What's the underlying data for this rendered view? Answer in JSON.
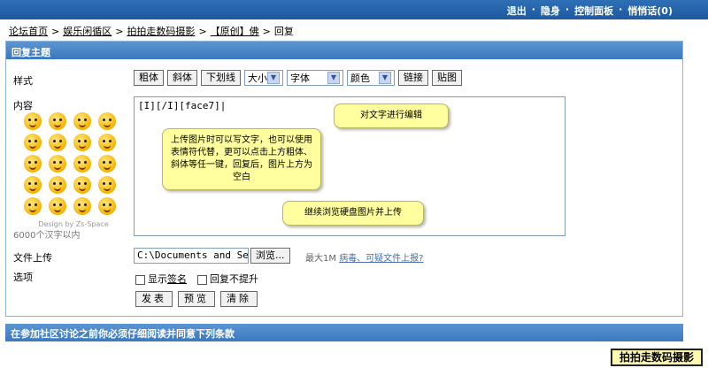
{
  "topbar": {
    "links": [
      "退出",
      "隐身",
      "控制面板",
      "悄悄话(0)"
    ]
  },
  "breadcrumb": [
    "论坛首页",
    "娱乐闲循区",
    "拍拍走数码摄影",
    "【原创】佛",
    "回复"
  ],
  "panel": {
    "title": "回复主题"
  },
  "labels": {
    "style": "样式",
    "content": "内容",
    "upload": "文件上传",
    "options": "选项"
  },
  "toolbar": {
    "bold": "粗体",
    "italic": "斜体",
    "underline": "下划线",
    "size": "大小",
    "font": "字体",
    "color": "颜色",
    "link": "链接",
    "image": "贴图"
  },
  "emoji_credit": "Design by Zs-Space",
  "char_limit": "6000个汉字以内",
  "content_text": "[I][/I][face7]",
  "file": {
    "value": "C:\\Documents and Sett",
    "browse": "浏览...",
    "hint_prefix": "最大1M",
    "hint_link": "病毒、可疑文件上报?"
  },
  "options": {
    "show_sig_prefix": "显示",
    "show_sig_link": "签名",
    "no_bump": "回复不提升"
  },
  "actions": {
    "post": "发表",
    "preview": "预览",
    "clear": "清除"
  },
  "callouts": {
    "edit": "对文字进行编辑",
    "upload_tip": "上传图片时可以写文字，也可以使用表情符代替，更可以点击上方粗体、斜体等任一键，回复后，图片上方为空白",
    "continue": "继续浏览硬盘图片并上传"
  },
  "bottom": {
    "title": "在参加社区讨论之前你必须仔细阅读并同意下列条款"
  },
  "watermark": "拍拍走数码摄影"
}
